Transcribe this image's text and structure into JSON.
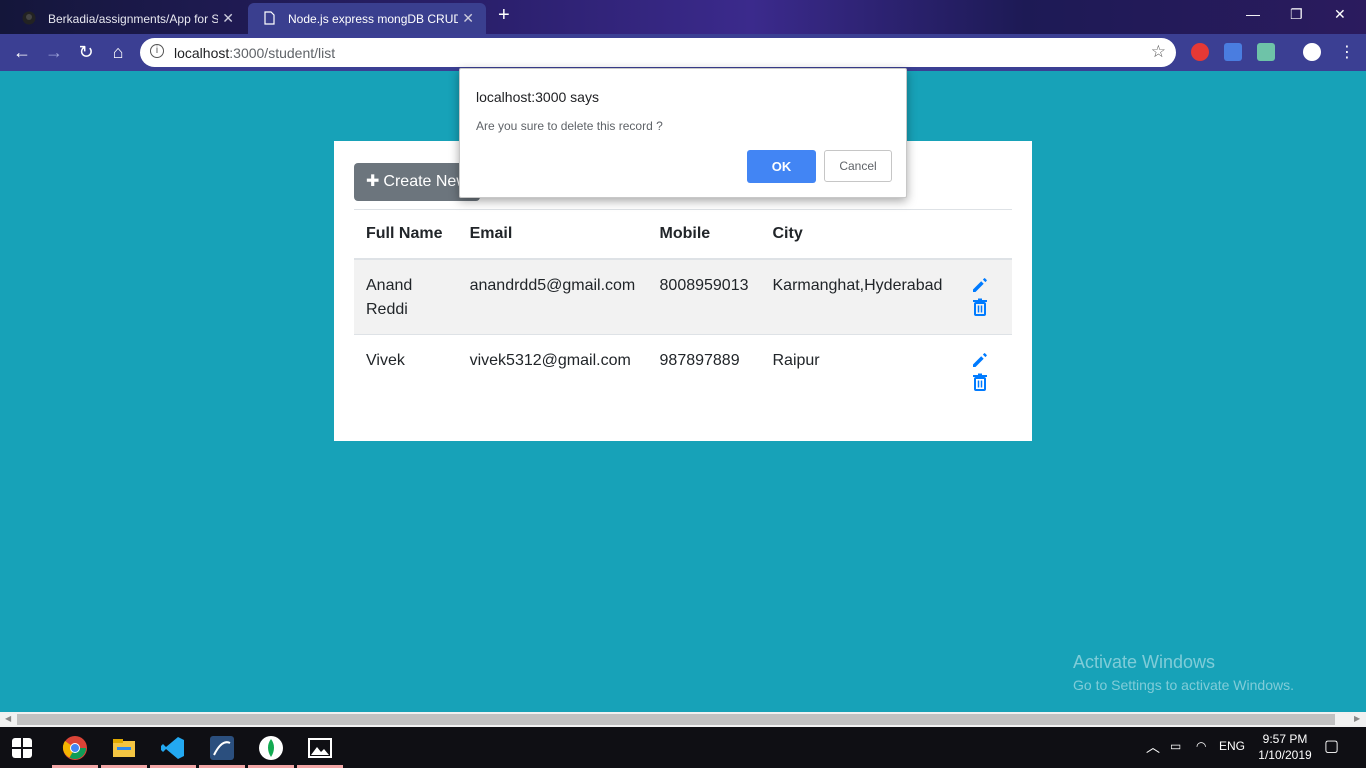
{
  "browser": {
    "tabs": [
      {
        "label": "Berkadia/assignments/App for St",
        "active": false
      },
      {
        "label": "Node.js express mongDB CRUD",
        "active": true
      }
    ],
    "url_host": "localhost",
    "url_path": ":3000/student/list"
  },
  "page": {
    "create_button_label": "Create New",
    "table": {
      "headers": [
        "Full Name",
        "Email",
        "Mobile",
        "City"
      ],
      "rows": [
        {
          "name_line1": "Anand",
          "name_line2": "Reddi",
          "email": "anandrdd5@gmail.com",
          "mobile": "8008959013",
          "city": "Karmanghat,Hyderabad"
        },
        {
          "name_line1": "Vivek",
          "name_line2": "",
          "email": "vivek5312@gmail.com",
          "mobile": "987897889",
          "city": "Raipur"
        }
      ]
    }
  },
  "dialog": {
    "title": "localhost:3000 says",
    "message": "Are you sure to delete this record ?",
    "ok_label": "OK",
    "cancel_label": "Cancel"
  },
  "watermark": {
    "line1": "Activate Windows",
    "line2": "Go to Settings to activate Windows."
  },
  "taskbar": {
    "language": "ENG",
    "time": "9:57 PM",
    "date": "1/10/2019"
  },
  "colors": {
    "page_bg": "#17a2b8",
    "ok_button": "#4285f4",
    "icon_blue": "#007bff",
    "create_button": "#6c757d"
  }
}
